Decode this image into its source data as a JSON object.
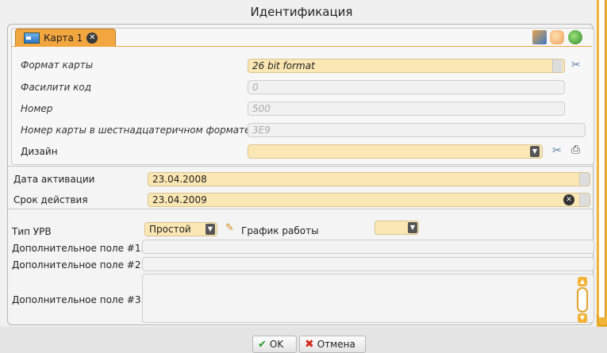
{
  "window": {
    "title": "Идентификация"
  },
  "tab": {
    "label": "Карта 1"
  },
  "icons": {
    "card": "card-icon",
    "tab_close": "close-icon",
    "tool1": "import-card-icon",
    "tool2": "hand-icon",
    "tool3": "refresh-icon",
    "clear": "clear-icon",
    "print": "printer-icon",
    "dropdown": "chevron-down-icon",
    "edit": "pencil-icon",
    "ok": "checkmark-icon",
    "cancel": "cross-icon"
  },
  "card": {
    "format_label": "Формат карты",
    "format_value": "26 bit format",
    "facility_label": "Фасилити код",
    "facility_value": "0",
    "number_label": "Номер",
    "number_value": "500",
    "hex_label": "Номер карты в шестнадцатеричном формате",
    "hex_value": "3E9",
    "design_label": "Дизайн",
    "design_value": ""
  },
  "dates": {
    "activation_label": "Дата активации",
    "activation_value": "23.04.2008",
    "expiry_label": "Срок действия",
    "expiry_value": "23.04.2009"
  },
  "access": {
    "type_label": "Тип УРВ",
    "type_value": "Простой",
    "schedule_label": "График работы",
    "schedule_value": ""
  },
  "extra": {
    "field1_label": "Дополнительное поле #1:",
    "field1_value": "",
    "field2_label": "Дополнительное поле #2:",
    "field2_value": "",
    "field3_label": "Дополнительное поле #3:",
    "field3_value": ""
  },
  "buttons": {
    "ok": "OK",
    "cancel": "Отмена"
  },
  "colors": {
    "accent": "#f2a640",
    "highlight_field": "#fbe7b3",
    "ok_icon": "#2a9b2a",
    "cancel_icon": "#d52a1a"
  }
}
